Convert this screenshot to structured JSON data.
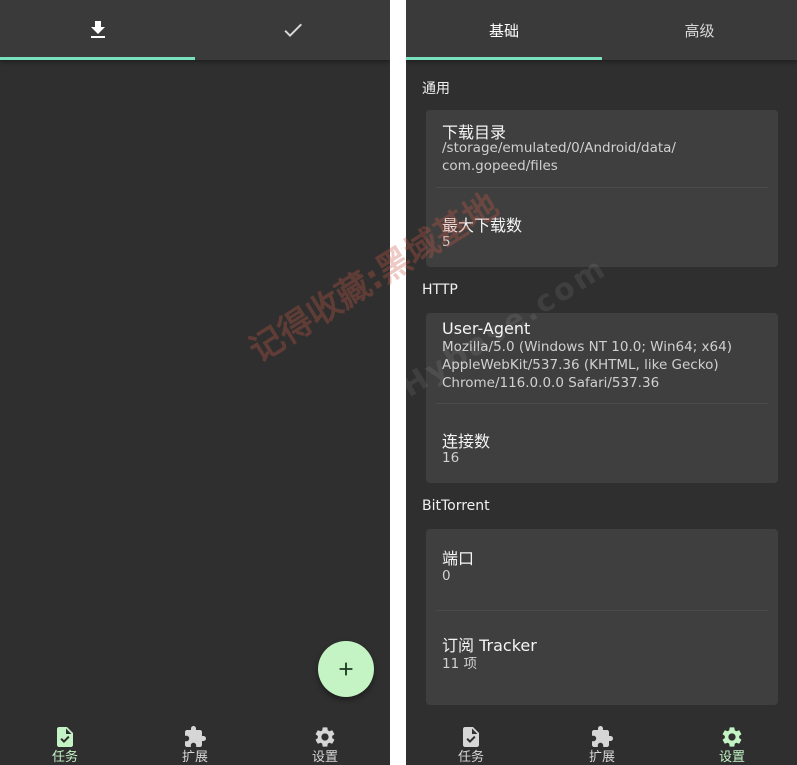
{
  "left": {
    "tabs": [
      {
        "icon": "download-icon",
        "active": true
      },
      {
        "icon": "check-icon",
        "active": false
      }
    ],
    "fab": {
      "icon": "plus-icon"
    },
    "nav": [
      {
        "label": "任务",
        "icon": "task-icon",
        "active": true
      },
      {
        "label": "扩展",
        "icon": "extension-icon",
        "active": false
      },
      {
        "label": "设置",
        "icon": "settings-icon",
        "active": false
      }
    ]
  },
  "right": {
    "tabs": [
      {
        "label": "基础",
        "active": true
      },
      {
        "label": "高级",
        "active": false
      }
    ],
    "sections": [
      {
        "title": "通用",
        "items": [
          {
            "title": "下载目录",
            "value_lines": [
              "/storage/emulated/0/Android/data/",
              "com.gopeed/files"
            ]
          },
          {
            "title": "最大下载数",
            "value_lines": [
              "5"
            ]
          }
        ]
      },
      {
        "title": "HTTP",
        "items": [
          {
            "title": "User-Agent",
            "value_lines": [
              "Mozilla/5.0 (Windows NT 10.0; Win64; x64)",
              "AppleWebKit/537.36 (KHTML, like Gecko)",
              "Chrome/116.0.0.0 Safari/537.36"
            ]
          },
          {
            "title": "连接数",
            "value_lines": [
              "16"
            ]
          }
        ]
      },
      {
        "title": "BitTorrent",
        "items": [
          {
            "title": "端口",
            "value_lines": [
              "0"
            ]
          },
          {
            "title": "订阅 Tracker",
            "value_lines": [
              "11 项"
            ]
          }
        ]
      }
    ],
    "nav": [
      {
        "label": "任务",
        "icon": "task-icon",
        "active": false
      },
      {
        "label": "扩展",
        "icon": "extension-icon",
        "active": false
      },
      {
        "label": "设置",
        "icon": "settings-icon",
        "active": true
      }
    ]
  },
  "watermark": {
    "text": "记得收藏:黑域基地",
    "domain": "Hybase.com"
  },
  "colors": {
    "accent": "#79e0bd",
    "fab": "#c4f3c4",
    "background": "#2f2f2f",
    "card": "#3f3f3f",
    "tabbar": "#3a3a3a"
  }
}
